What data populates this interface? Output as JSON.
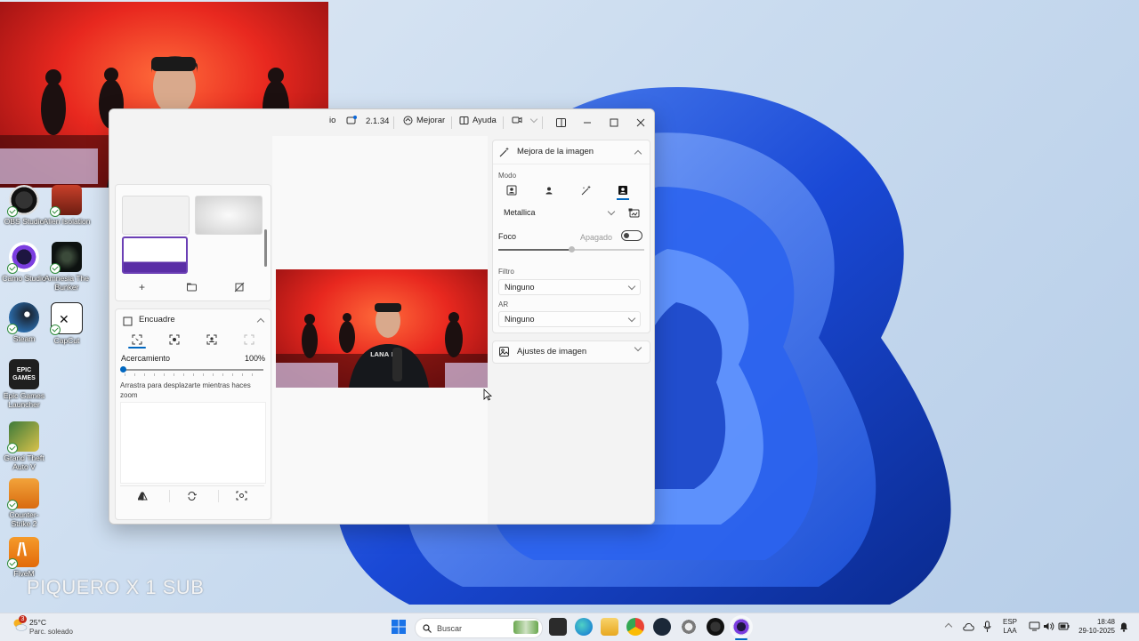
{
  "desktop": {
    "icons": [
      {
        "label": "OBS Studio",
        "name": "obs-studio"
      },
      {
        "label": "Alien Isolation",
        "name": "alien-isolation"
      },
      {
        "label": "Camo Studio",
        "name": "camo-studio"
      },
      {
        "label": "Amnesia The Bunker",
        "name": "amnesia-the-bunker"
      },
      {
        "label": "Steam",
        "name": "steam"
      },
      {
        "label": "CapCut",
        "name": "capcut"
      },
      {
        "label": "Epic Games Launcher",
        "name": "epic-games-launcher"
      },
      {
        "label": "Grand Theft Auto V",
        "name": "grand-theft-auto-v"
      },
      {
        "label": "Counter-Strike 2",
        "name": "counter-strike-2"
      },
      {
        "label": "FiveM",
        "name": "fivem"
      }
    ],
    "overlay_text": "PIQUERO X 1 SUB",
    "epic_badge": "EPIC GAMES"
  },
  "window": {
    "title_fragment": "io",
    "version": "2.1.34",
    "enhance_label": "Mejorar",
    "help_label": "Ayuda",
    "left": {
      "framing_title": "Encuadre",
      "zoom_label": "Acercamiento",
      "zoom_value": "100%",
      "zoom_level": 0,
      "pan_hint": "Arrastra para desplazarte mientras haces zoom"
    },
    "right": {
      "enhance_title": "Mejora de la imagen",
      "mode_label": "Modo",
      "preset_value": "Metallica",
      "focus_label": "Foco",
      "focus_state": "Apagado",
      "focus_level": 0.5,
      "filter_label": "Filtro",
      "filter_value": "Ninguno",
      "ar_label": "AR",
      "ar_value": "Ninguno",
      "image_settings_title": "Ajustes de imagen"
    }
  },
  "taskbar": {
    "weather_temp": "25°C",
    "weather_desc": "Parc. soleado",
    "weather_badge": "3",
    "search_placeholder": "Buscar",
    "lang_top": "ESP",
    "lang_bottom": "LAA",
    "time": "18:48",
    "date": "29-10-2025"
  },
  "colors": {
    "accent": "#0067c0",
    "wallpaper_blue": "#1b4fd8",
    "selected_border": "#6b3fb5"
  }
}
